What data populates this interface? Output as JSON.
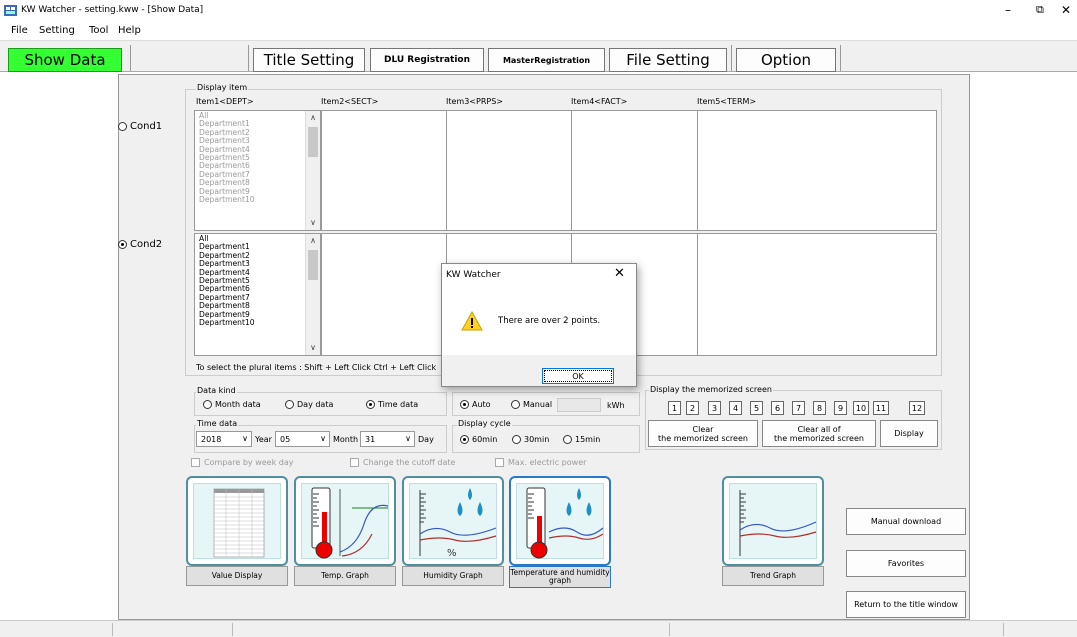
{
  "window": {
    "title": "KW Watcher - setting.kww - [Show Data]",
    "controls": [
      "–",
      "⧉",
      "✕"
    ]
  },
  "menu": [
    "File",
    "Setting",
    "Tool",
    "Help"
  ],
  "toolbar": {
    "show_data": "Show Data",
    "title_setting": "Title Setting",
    "dlu_registration": "DLU Registration",
    "master_registration": "MasterRegistration",
    "file_setting": "File Setting",
    "option": "Option",
    "active_color": "#33ff33"
  },
  "display_item": {
    "label": "Display item",
    "columns": [
      "Item1<DEPT>",
      "Item2<SECT>",
      "Item3<PRPS>",
      "Item4<FACT>",
      "Item5<TERM>"
    ],
    "cond1": "Cond1",
    "cond2": "Cond2",
    "selected_cond": "Cond2",
    "list_items": [
      "All",
      "Department1",
      "Department2",
      "Department3",
      "Department4",
      "Department5",
      "Department6",
      "Department7",
      "Department8",
      "Department9",
      "Department10"
    ],
    "hint": "To select the plural items : Shift + Left Click  Ctrl + Left Click"
  },
  "data_kind": {
    "label": "Data kind",
    "options": [
      "Month data",
      "Day data",
      "Time data"
    ],
    "selected": "Time data"
  },
  "time_data": {
    "label": "Time data",
    "year": "2018",
    "year_unit": "Year",
    "month": "05",
    "month_unit": "Month",
    "day": "31",
    "day_unit": "Day"
  },
  "scale": {
    "options": [
      "Auto",
      "Manual"
    ],
    "selected": "Auto",
    "unit": "kWh"
  },
  "display_cycle": {
    "label": "Display cycle",
    "options": [
      "60min",
      "30min",
      "15min"
    ],
    "selected": "60min"
  },
  "checks": [
    "Compare by week day",
    "Change the cutoff date",
    "Max. electric power"
  ],
  "memorized": {
    "label": "Display the memorized screen",
    "numbers": [
      "1",
      "2",
      "3",
      "4",
      "5",
      "6",
      "7",
      "8",
      "9",
      "10",
      "11",
      "12"
    ],
    "clear": "Clear\nthe memorized screen",
    "clear_all": "Clear all of\nthe memorized screen",
    "display": "Display"
  },
  "graph_buttons": [
    "Value Display",
    "Temp. Graph",
    "Humidity Graph",
    "Temperature and humidity graph",
    "Trend Graph"
  ],
  "side_buttons": {
    "manual_download": "Manual download",
    "favorites": "Favorites",
    "return": "Return to the title window"
  },
  "dialog": {
    "title": "KW Watcher",
    "message": "There are over 2 points.",
    "ok": "OK"
  }
}
